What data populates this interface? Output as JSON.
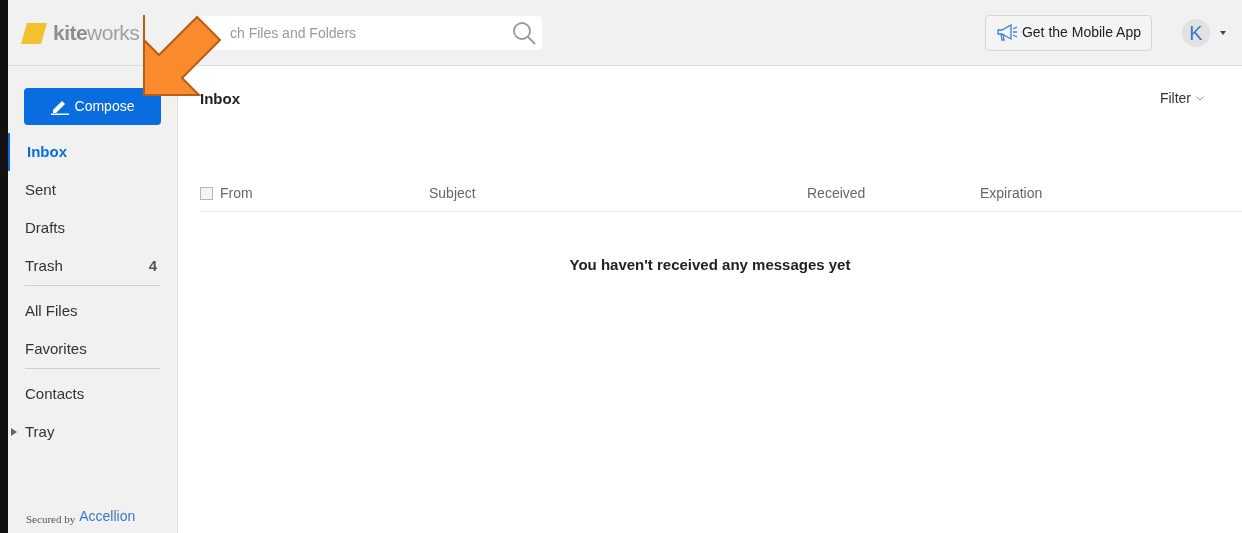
{
  "header": {
    "logo": {
      "part1": "kite",
      "part2": "works"
    },
    "search": {
      "placeholder": "ch Files and Folders"
    },
    "mobile_app_button": "Get the Mobile App",
    "avatar": "K"
  },
  "compose_button": "Compose",
  "sidebar": {
    "groups": [
      [
        {
          "label": "Inbox",
          "selected": true
        },
        {
          "label": "Sent",
          "selected": false
        },
        {
          "label": "Drafts",
          "selected": false
        },
        {
          "label": "Trash",
          "selected": false,
          "count": "4"
        }
      ],
      [
        {
          "label": "All Files",
          "selected": false
        },
        {
          "label": "Favorites",
          "selected": false
        }
      ],
      [
        {
          "label": "Contacts",
          "selected": false
        },
        {
          "label": "Tray",
          "selected": false,
          "expanded": false
        }
      ]
    ],
    "footer": {
      "prefix": "Secured by",
      "brand": "Accellion"
    }
  },
  "main": {
    "title": "Inbox",
    "filter": "Filter",
    "table": {
      "select_all_checked": false,
      "columns": [
        "From",
        "Subject",
        "Received",
        "Expiration"
      ]
    },
    "empty_message": "You haven't received any messages yet"
  }
}
